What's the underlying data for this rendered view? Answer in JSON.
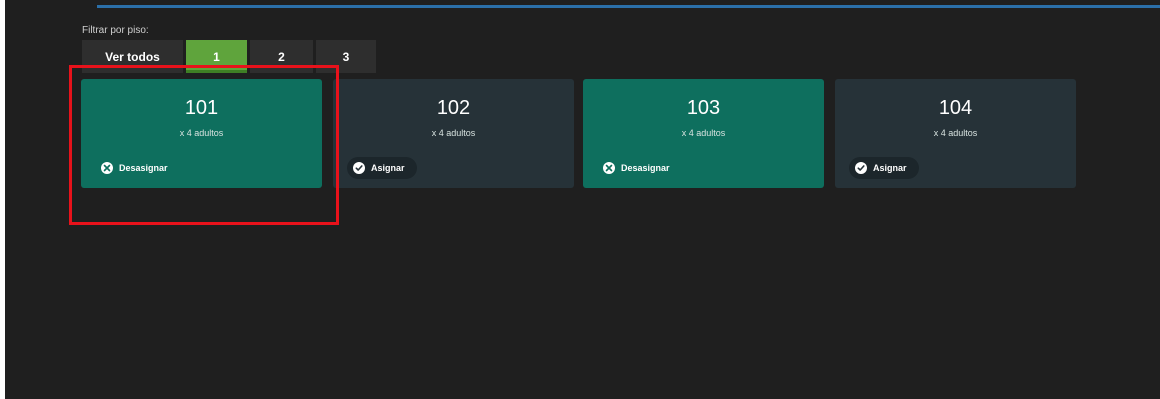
{
  "filter": {
    "label": "Filtrar por piso:",
    "options": [
      {
        "label": "Ver todos",
        "active": false
      },
      {
        "label": "1",
        "active": true
      },
      {
        "label": "2",
        "active": false
      },
      {
        "label": "3",
        "active": false
      }
    ]
  },
  "rooms": [
    {
      "number": "101",
      "capacity": "x 4 adultos",
      "action": "Desasignar",
      "assigned": true
    },
    {
      "number": "102",
      "capacity": "x 4 adultos",
      "action": "Asignar",
      "assigned": false
    },
    {
      "number": "103",
      "capacity": "x 4 adultos",
      "action": "Desasignar",
      "assigned": true
    },
    {
      "number": "104",
      "capacity": "x 4 adultos",
      "action": "Asignar",
      "assigned": false
    }
  ],
  "colors": {
    "background": "#1f1f1f",
    "assigned_card": "#0e6f5e",
    "unassigned_card": "#263238",
    "active_filter": "#5fa43c",
    "highlight": "#e8121b"
  },
  "icons": {
    "unassign": "close-circle-icon",
    "assign": "check-circle-icon"
  }
}
